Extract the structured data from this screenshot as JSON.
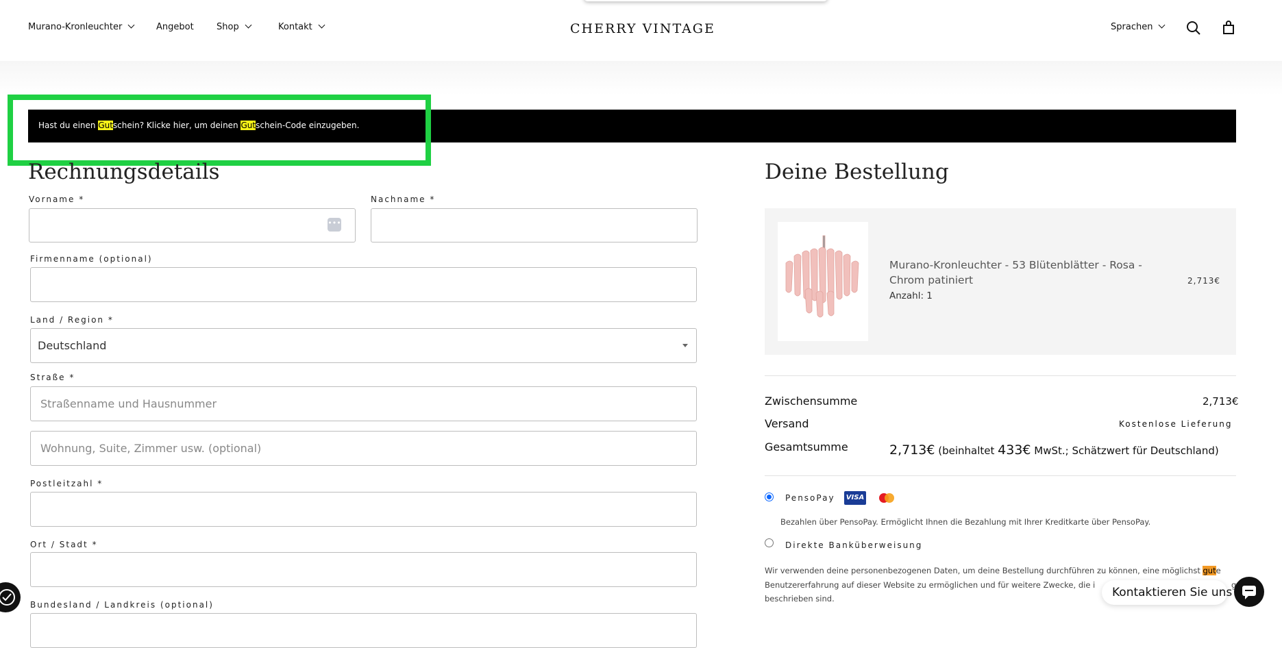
{
  "header": {
    "nav": [
      {
        "label": "Murano-Kronleuchter"
      },
      {
        "label": "Angebot"
      },
      {
        "label": "Shop"
      },
      {
        "label": "Kontakt"
      }
    ],
    "brand": "CHERRY VINTAGE",
    "language_label": "Sprachen"
  },
  "coupon": {
    "part1": "Hast du einen ",
    "hl1": "Gut",
    "part2": "schein? Klicke hier, um deinen ",
    "hl2": "Gut",
    "part3": "schein-Code einzugeben."
  },
  "billing": {
    "heading": "Rechnungsdetails",
    "fields": {
      "first_name_label": "Vorname *",
      "last_name_label": "Nachname *",
      "company_label": "Firmenname (optional)",
      "country_label": "Land / Region *",
      "country_value": "Deutschland",
      "street_label": "Straße *",
      "street_placeholder": "Straßenname und Hausnummer",
      "address2_placeholder": "Wohnung, Suite, Zimmer usw. (optional)",
      "postcode_label": "Postleitzahl *",
      "city_label": "Ort / Stadt *",
      "state_label": "Bundesland / Landkreis (optional)"
    }
  },
  "order": {
    "heading": "Deine Bestellung",
    "product": {
      "name": "Murano-Kronleuchter - 53 Blütenblätter - Rosa - Chrom patiniert",
      "qty": "Anzahl: 1",
      "price": "2,713€"
    },
    "subtotal_label": "Zwischensumme",
    "subtotal_value": "2,713€",
    "shipping_label": "Versand",
    "shipping_value": "Kostenlose Lieferung",
    "total_label": "Gesamtsumme",
    "total_value": "2,713€",
    "tax_prefix": "(beinhaltet ",
    "tax_amount": "433€",
    "tax_suffix": " MwSt.; Schätzwert für Deutschland)"
  },
  "payment": {
    "pensopay_label": "PensoPay",
    "pensopay_desc": "Bezahlen über PensoPay. Ermöglicht Ihnen die Bezahlung mit Ihrer Kreditkarte über PensoPay.",
    "bank_label": "Direkte Banküberweisung",
    "visa": "VISA",
    "privacy_line1_a": "Wir verwenden deine personenbezogenen Daten, um deine Bestellung durchführen zu können, eine möglichst ",
    "privacy_hl": "gut",
    "privacy_line1_b": "e",
    "privacy_line2": "Benutzererfahrung auf dieser Website zu ermöglichen und für weitere Zwecke, die i",
    "privacy_line2_end": "g",
    "privacy_line3": "beschrieben sind."
  },
  "chat": {
    "label": "Kontaktieren Sie uns"
  },
  "colors": {
    "highlight_yellow": "#f6f318",
    "highlight_orange": "#f39a26",
    "annotation_green": "#1fd043",
    "radio_blue": "#0a66ff"
  }
}
